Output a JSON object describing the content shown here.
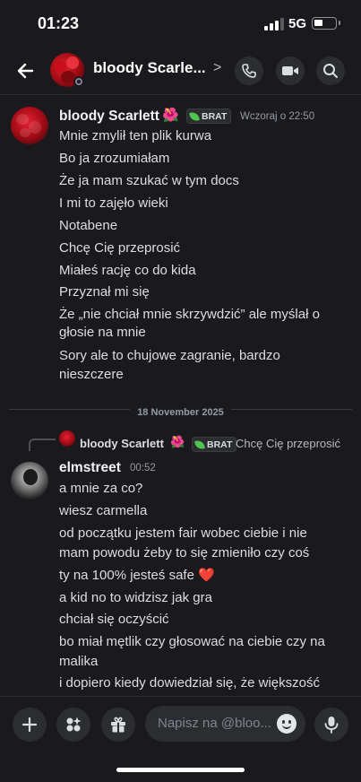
{
  "status_bar": {
    "time": "01:23",
    "network": "5G"
  },
  "header": {
    "title": "bloody Scarle...",
    "chevron": ">"
  },
  "colors": {
    "background": "#1a1a1e",
    "accent_green": "#4fc54f",
    "text": "#dbdee1",
    "muted": "#949ba4"
  },
  "icons": [
    "back-arrow-icon",
    "phone-icon",
    "video-icon",
    "search-icon",
    "plus-icon",
    "apps-icon",
    "gift-icon",
    "emoji-icon",
    "mic-icon"
  ],
  "messages": {
    "first": {
      "author": "bloody Scarlett",
      "flower": "🌺",
      "tag": "BRAT",
      "timestamp": "Wczoraj o 22:50",
      "lines": [
        "Mnie zmylił ten plik kurwa",
        "Bo ja zrozumiałam",
        "Że ja mam szukać w tym docs",
        "I mi to zajęło wieki",
        "Notabene",
        "Chcę Cię przeprosić",
        "Miałeś rację co do kida",
        "Przyznał mi się",
        "Że „nie chciał mnie skrzywdzić” ale myślał o",
        "głosie na mnie",
        "Sory ale to chujowe zagranie, bardzo",
        "nieszczere"
      ]
    },
    "divider": "18 November 2025",
    "reply": {
      "author": "bloody Scarlett",
      "flower": "🌺",
      "tag": "BRAT",
      "text": "Chcę Cię przeprosić"
    },
    "second": {
      "author": "elmstreet",
      "timestamp": "00:52",
      "lines": [
        "a mnie za co?",
        "wiesz carmella",
        "od początku jestem fair wobec ciebie i nie",
        "mam powodu żeby to się zmieniło czy coś",
        "ty na 100% jesteś safe ❤️",
        "a kid no to widzisz jak gra",
        "chciał się oczyścić",
        "bo miał mętlik czy głosować na ciebie czy na",
        "malika",
        "i dopiero kiedy dowiedział się, że większość"
      ]
    }
  },
  "composer": {
    "placeholder": "Napisz na @bloo..."
  }
}
